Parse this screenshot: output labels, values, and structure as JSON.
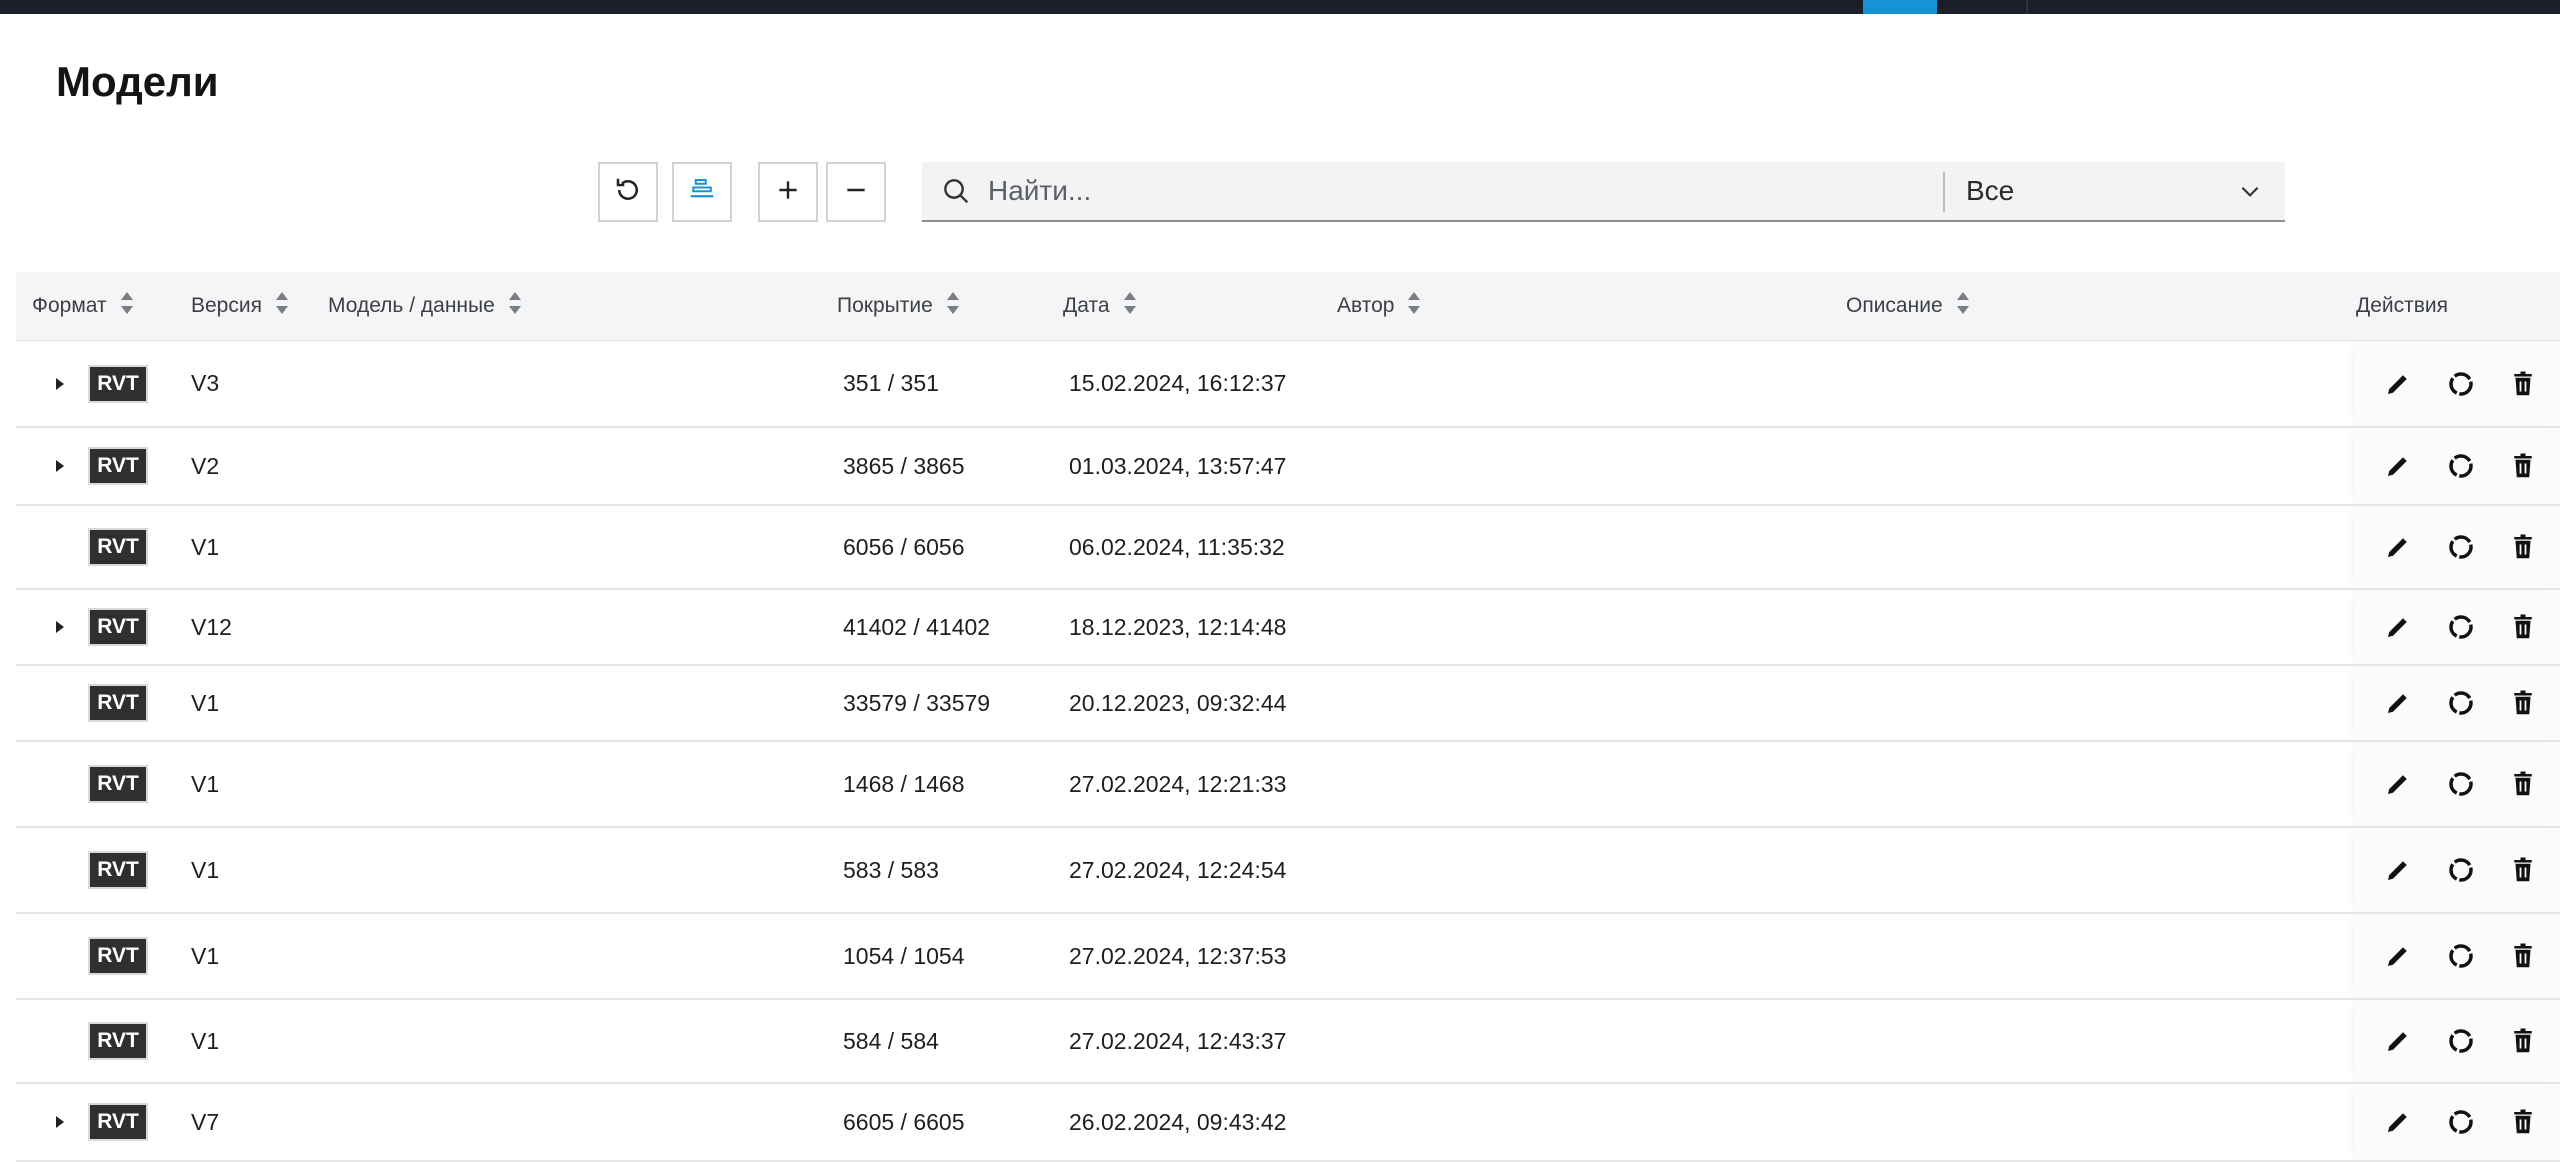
{
  "page": {
    "title": "Модели"
  },
  "toolbar": {
    "search_placeholder": "Найти...",
    "filter_value": "Все",
    "icons": {
      "refresh": "refresh-icon",
      "layers": "layers-icon",
      "expand": "plus-icon",
      "collapse": "minus-icon"
    }
  },
  "colors": {
    "accent": "#1593d4",
    "topbar": "#1c1f2a",
    "badge": "#2f2f2f"
  },
  "table": {
    "columns": {
      "format": "Формат",
      "version": "Версия",
      "model": "Модель / данные",
      "coverage": "Покрытие",
      "date": "Дата",
      "author": "Автор",
      "description": "Описание",
      "actions": "Действия"
    },
    "rows": [
      {
        "expandable": true,
        "format": "RVT",
        "version": "V3",
        "model": "",
        "coverage": "351 / 351",
        "date": "15.02.2024, 16:12:37",
        "author": "",
        "description": ""
      },
      {
        "expandable": true,
        "format": "RVT",
        "version": "V2",
        "model": "",
        "coverage": "3865 / 3865",
        "date": "01.03.2024, 13:57:47",
        "author": "",
        "description": ""
      },
      {
        "expandable": false,
        "format": "RVT",
        "version": "V1",
        "model": "",
        "coverage": "6056 / 6056",
        "date": "06.02.2024, 11:35:32",
        "author": "",
        "description": ""
      },
      {
        "expandable": true,
        "format": "RVT",
        "version": "V12",
        "model": "",
        "coverage": "41402 / 41402",
        "date": "18.12.2023, 12:14:48",
        "author": "",
        "description": ""
      },
      {
        "expandable": false,
        "format": "RVT",
        "version": "V1",
        "model": "",
        "coverage": "33579 / 33579",
        "date": "20.12.2023, 09:32:44",
        "author": "",
        "description": ""
      },
      {
        "expandable": false,
        "format": "RVT",
        "version": "V1",
        "model": "",
        "coverage": "1468 / 1468",
        "date": "27.02.2024, 12:21:33",
        "author": "",
        "description": ""
      },
      {
        "expandable": false,
        "format": "RVT",
        "version": "V1",
        "model": "",
        "coverage": "583 / 583",
        "date": "27.02.2024, 12:24:54",
        "author": "",
        "description": ""
      },
      {
        "expandable": false,
        "format": "RVT",
        "version": "V1",
        "model": "",
        "coverage": "1054 / 1054",
        "date": "27.02.2024, 12:37:53",
        "author": "",
        "description": ""
      },
      {
        "expandable": false,
        "format": "RVT",
        "version": "V1",
        "model": "",
        "coverage": "584 / 584",
        "date": "27.02.2024, 12:43:37",
        "author": "",
        "description": ""
      },
      {
        "expandable": true,
        "format": "RVT",
        "version": "V7",
        "model": "",
        "coverage": "6605 / 6605",
        "date": "26.02.2024, 09:43:42",
        "author": "",
        "description": ""
      }
    ]
  }
}
